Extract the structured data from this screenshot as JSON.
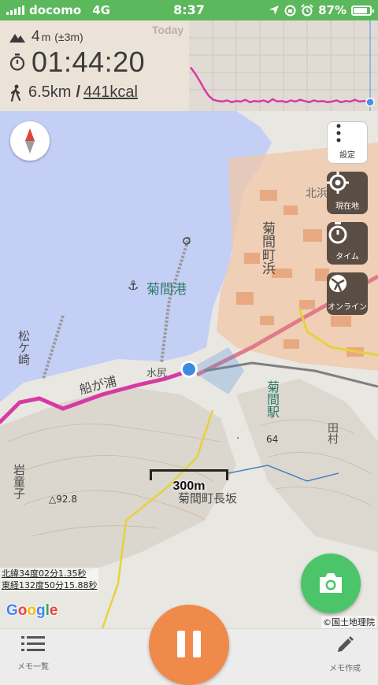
{
  "status_bar": {
    "carrier": "docomo",
    "network": "4G",
    "time": "8:37",
    "battery": "87%",
    "battery_level": 0.87
  },
  "stats": {
    "altitude_value": "4",
    "altitude_unit": "m",
    "altitude_accuracy": "(±3m)",
    "elapsed_time": "01:44:20",
    "distance": "6.5km",
    "separator": "/",
    "calories": "441kcal",
    "chart_label": "Today"
  },
  "chart_data": {
    "type": "line",
    "title": "Today",
    "xlabel": "",
    "ylabel": "",
    "series_color": "#d63aa3",
    "y_top_tick": "300",
    "values": [
      60,
      50,
      38,
      25,
      14,
      8,
      6,
      5,
      7,
      4,
      6,
      5,
      8,
      4,
      6,
      5,
      7,
      4,
      9,
      5,
      6,
      4,
      7,
      5,
      8,
      6,
      4,
      7,
      5,
      6,
      4,
      5,
      7,
      4,
      6,
      5,
      8,
      5,
      6,
      4
    ]
  },
  "map": {
    "labels": {
      "port": "菊間港",
      "town": "菊間町浜",
      "station": "菊間駅",
      "cape": "松ケ崎",
      "funagaura": "船が浦",
      "nagasaka": "菊間町長坂",
      "iwadoko": "岩童子",
      "kitahama": "北浜",
      "mizuzaki": "水尻",
      "taden": "田村",
      "elev_1": "△92.8",
      "elev_2": "64"
    },
    "scale": "300m",
    "coords_lat": "北緯34度02分1.35秒",
    "coords_lon": "東経132度50分15.88秒",
    "copyright": "©国土地理院",
    "google": "Google"
  },
  "side_buttons": {
    "settings": "設定",
    "current_location": "現在地",
    "time": "タイム",
    "online": "オンライン"
  },
  "bottom_bar": {
    "memo_list": "メモ一覧",
    "memo_new": "メモ作成"
  },
  "colors": {
    "status_bar": "#5cb85c",
    "track": "#d63aa3",
    "pause_button": "#ef8a4a",
    "camera_button": "#4cc46a",
    "sea": "#c4cff5",
    "side_button": "#5a4d43"
  }
}
